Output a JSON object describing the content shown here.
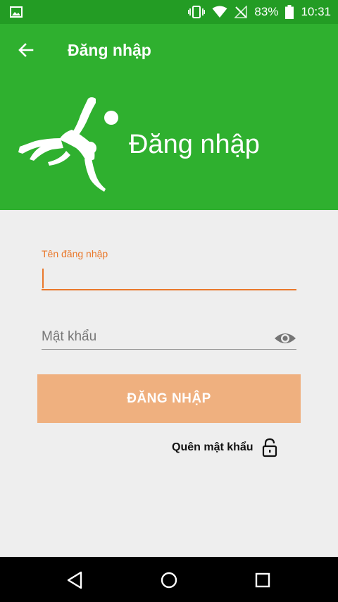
{
  "status_bar": {
    "battery": "83%",
    "time": "10:31"
  },
  "app_bar": {
    "title": "Đăng nhập"
  },
  "hero": {
    "title": "Đăng nhập"
  },
  "form": {
    "username_label": "Tên đăng nhập",
    "username_value": "",
    "password_placeholder": "Mật khẩu",
    "login_button": "ĐĂNG NHẬP",
    "forgot_password": "Quên mật khẩu"
  },
  "icons": {
    "status_left": "image-icon",
    "vibrate": "vibrate-icon",
    "wifi": "wifi-icon",
    "no_signal": "no-signal-icon",
    "battery": "battery-icon",
    "back": "arrow-back-icon",
    "logo": "football-player-icon",
    "eye": "eye-icon",
    "lock": "unlock-icon"
  },
  "colors": {
    "primary_dark": "#239c24",
    "primary": "#2fb02f",
    "accent": "#e9782b",
    "button": "#efb07f",
    "background": "#eeeeee"
  }
}
